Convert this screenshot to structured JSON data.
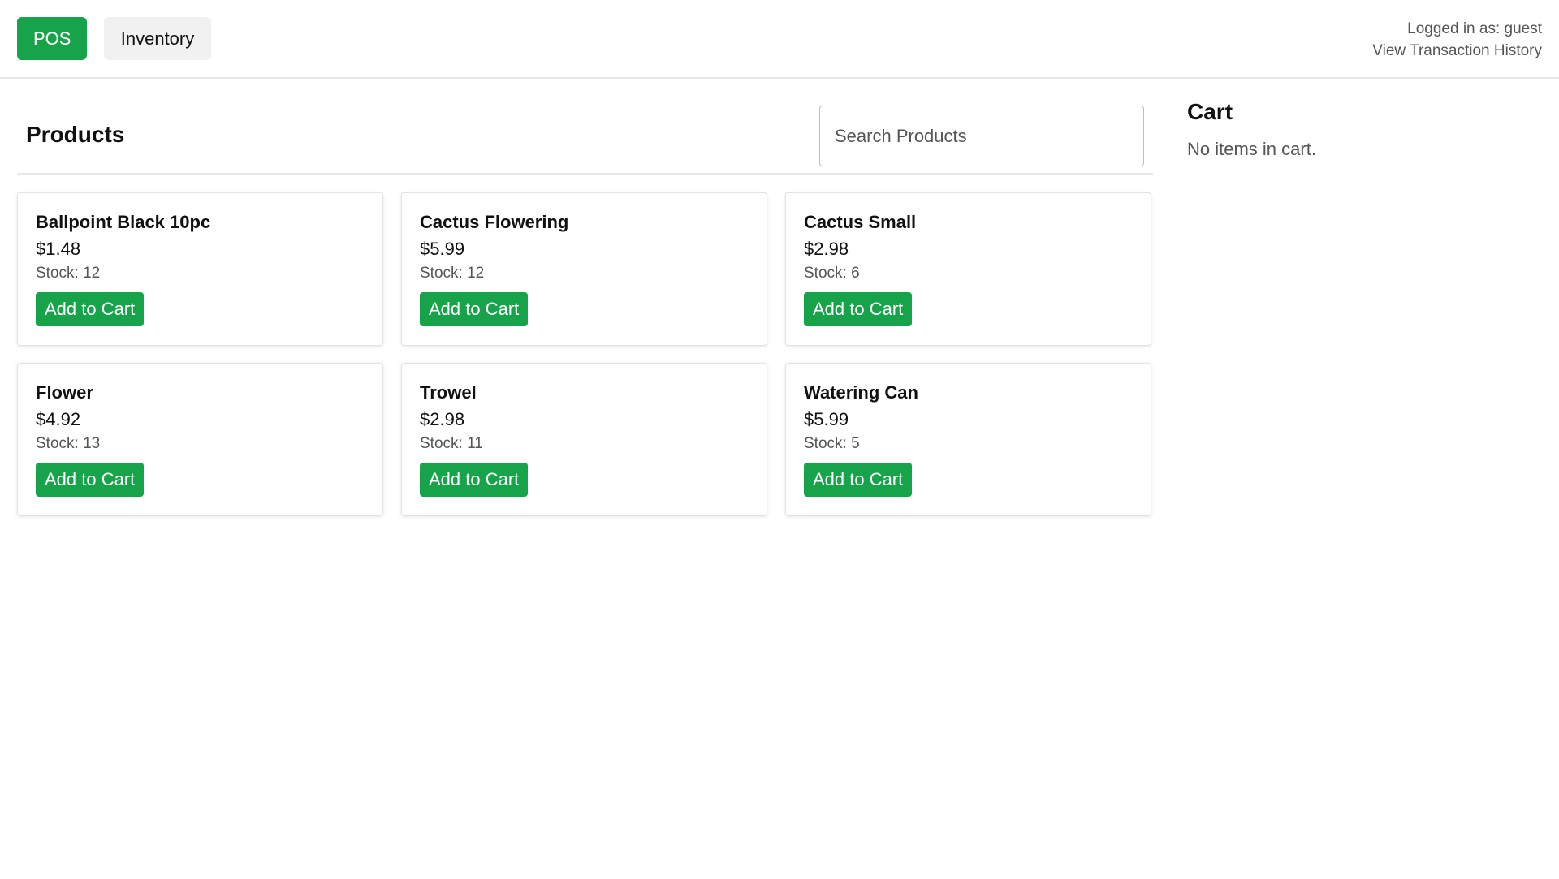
{
  "header": {
    "nav": {
      "pos_label": "POS",
      "inventory_label": "Inventory"
    },
    "user": {
      "logged_in_text": "Logged in as: guest",
      "history_link": "View Transaction History"
    },
    "colors": {
      "accent": "#16a34a",
      "secondary_button": "#f1f1f1"
    }
  },
  "products": {
    "title": "Products",
    "search": {
      "placeholder": "Search Products",
      "value": ""
    },
    "items": [
      {
        "name": "Ballpoint Black 10pc",
        "price": "$1.48",
        "stock": "Stock: 12",
        "button": "Add to Cart"
      },
      {
        "name": "Cactus Flowering",
        "price": "$5.99",
        "stock": "Stock: 12",
        "button": "Add to Cart"
      },
      {
        "name": "Cactus Small",
        "price": "$2.98",
        "stock": "Stock: 6",
        "button": "Add to Cart"
      },
      {
        "name": "Flower",
        "price": "$4.92",
        "stock": "Stock: 13",
        "button": "Add to Cart"
      },
      {
        "name": "Trowel",
        "price": "$2.98",
        "stock": "Stock: 11",
        "button": "Add to Cart"
      },
      {
        "name": "Watering Can",
        "price": "$5.99",
        "stock": "Stock: 5",
        "button": "Add to Cart"
      }
    ]
  },
  "cart": {
    "title": "Cart",
    "empty_message": "No items in cart."
  }
}
